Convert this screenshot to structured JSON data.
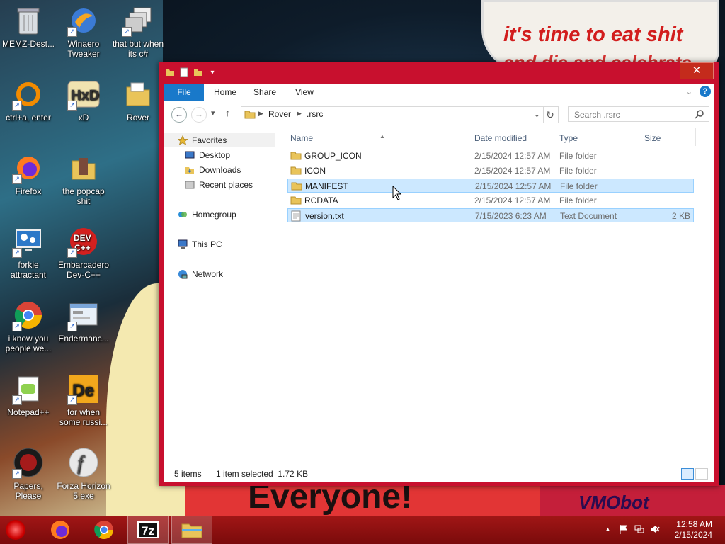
{
  "wallpaper": {
    "banner_line1": "it's time to eat shit",
    "banner_line2": "and die and celebrate",
    "bottom_text": "Everyone!",
    "bottom_right_text": "VMObot"
  },
  "desktop_icons": [
    {
      "label": "MEMZ-Dest...",
      "icon": "recycle-bin-icon"
    },
    {
      "label": "Winaero Tweaker",
      "icon": "winaero-icon"
    },
    {
      "label": "that but when its c#",
      "icon": "windows-stack-icon"
    },
    {
      "label": "ctrl+a, enter",
      "icon": "orange-ring-icon"
    },
    {
      "label": "xD",
      "icon": "hxd-icon"
    },
    {
      "label": "Rover",
      "icon": "folder-icon"
    },
    {
      "label": "Firefox",
      "icon": "firefox-icon"
    },
    {
      "label": "the popcap shit",
      "icon": "popcap-icon"
    },
    {
      "label": "forkie attractant",
      "icon": "gear-monitor-icon"
    },
    {
      "label": "Embarcadero Dev-C++",
      "icon": "devcpp-icon"
    },
    {
      "label": "i know you people we...",
      "icon": "chrome-icon"
    },
    {
      "label": "Endermanc...",
      "icon": "window-app-icon"
    },
    {
      "label": "Notepad++",
      "icon": "notepadpp-icon"
    },
    {
      "label": "for when some russi...",
      "icon": "de-icon"
    },
    {
      "label": "Papers, Please",
      "icon": "papers-please-icon"
    },
    {
      "label": "Forza Horizon 5.exe",
      "icon": "flash-icon"
    }
  ],
  "window": {
    "title": ".rsrc",
    "close_label": "✕",
    "ribbon_tabs": [
      "File",
      "Home",
      "Share",
      "View"
    ],
    "help_label": "?",
    "breadcrumbs": [
      "Rover",
      ".rsrc"
    ],
    "search_placeholder": "Search .rsrc",
    "nav": {
      "favorites": "Favorites",
      "desktop": "Desktop",
      "downloads": "Downloads",
      "recent": "Recent places",
      "homegroup": "Homegroup",
      "thispc": "This PC",
      "network": "Network"
    },
    "columns": {
      "name": "Name",
      "date": "Date modified",
      "type": "Type",
      "size": "Size"
    },
    "files": [
      {
        "name": "GROUP_ICON",
        "date": "2/15/2024 12:57 AM",
        "type": "File folder",
        "size": "",
        "kind": "folder",
        "selected": false
      },
      {
        "name": "ICON",
        "date": "2/15/2024 12:57 AM",
        "type": "File folder",
        "size": "",
        "kind": "folder",
        "selected": false
      },
      {
        "name": "MANIFEST",
        "date": "2/15/2024 12:57 AM",
        "type": "File folder",
        "size": "",
        "kind": "folder",
        "selected": true
      },
      {
        "name": "RCDATA",
        "date": "2/15/2024 12:57 AM",
        "type": "File folder",
        "size": "",
        "kind": "folder",
        "selected": false
      },
      {
        "name": "version.txt",
        "date": "7/15/2023 6:23 AM",
        "type": "Text Document",
        "size": "2 KB",
        "kind": "text",
        "selected": true
      }
    ],
    "status": {
      "count": "5 items",
      "selection": "1 item selected  1.72 KB"
    }
  },
  "taskbar": {
    "apps": [
      "firefox-icon",
      "chrome-icon",
      "7zip-icon",
      "explorer-icon"
    ],
    "sevenzip_label": "7z",
    "tray_up": "▲",
    "time": "12:58 AM",
    "date": "2/15/2024"
  },
  "colors": {
    "window_border": "#c8102e",
    "file_tab": "#1979ca",
    "selection": "#cce8ff",
    "taskbar": "#a11616"
  }
}
